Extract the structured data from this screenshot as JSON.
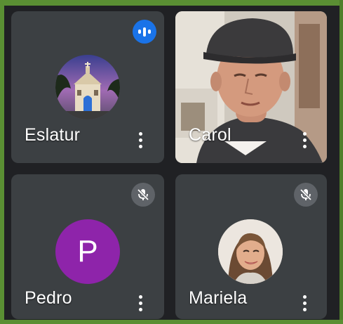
{
  "participants": [
    {
      "name": "Eslatur",
      "status": "speaking",
      "avatar": "church-photo"
    },
    {
      "name": "Carol",
      "status": "video",
      "avatar": "camera-feed"
    },
    {
      "name": "Pedro",
      "status": "muted",
      "avatar_letter": "P",
      "avatar_color": "#8e24aa"
    },
    {
      "name": "Mariela",
      "status": "muted",
      "avatar": "woman-photo"
    }
  ],
  "colors": {
    "tile_bg": "#3c4043",
    "speaking_badge": "#1a73e8",
    "muted_badge": "#5f6368",
    "frame": "#5a8f33"
  },
  "icons": {
    "speaking": "audio-wave-icon",
    "muted": "mic-off-icon",
    "more": "more-vert-icon"
  }
}
